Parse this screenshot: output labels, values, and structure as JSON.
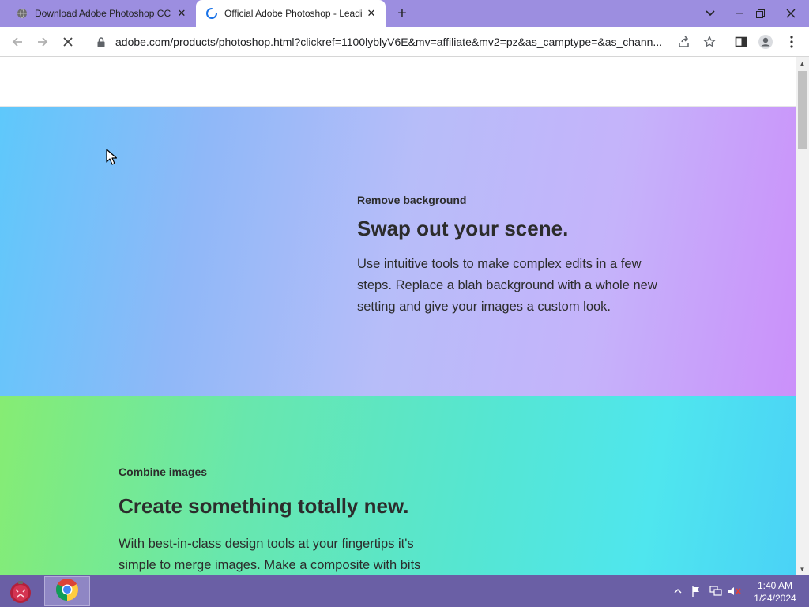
{
  "browser": {
    "tabs": [
      {
        "title": "Download Adobe Photoshop CC",
        "active": false,
        "loading": false
      },
      {
        "title": "Official Adobe Photoshop - Leadi",
        "active": true,
        "loading": true
      }
    ],
    "new_tab": "+",
    "url": "adobe.com/products/photoshop.html?clickref=1100lyblyV6E&mv=affiliate&mv2=pz&as_camptype=&as_chann..."
  },
  "sections": [
    {
      "eyebrow": "Remove background",
      "heading": "Swap out your scene.",
      "body_lines": [
        "Use intuitive tools to make complex edits in a few",
        "steps. Replace a blah background with a whole new",
        "setting and give your images a custom look."
      ]
    },
    {
      "eyebrow": "Combine images",
      "heading": "Create something totally new.",
      "body_lines": [
        "With best-in-class design tools at your fingertips it's",
        "simple to merge images. Make a composite with bits"
      ]
    }
  ],
  "taskbar": {
    "time": "1:40 AM",
    "date": "1/24/2024"
  },
  "colors": {
    "tab_strip": "#9c8ee0",
    "taskbar": "#6a5fa5",
    "section1_gradient": [
      "#5ec8fb",
      "#b7bdf9",
      "#cb90fa"
    ],
    "section2_gradient": [
      "#86ec73",
      "#55e6d3",
      "#4ad1f7"
    ]
  }
}
